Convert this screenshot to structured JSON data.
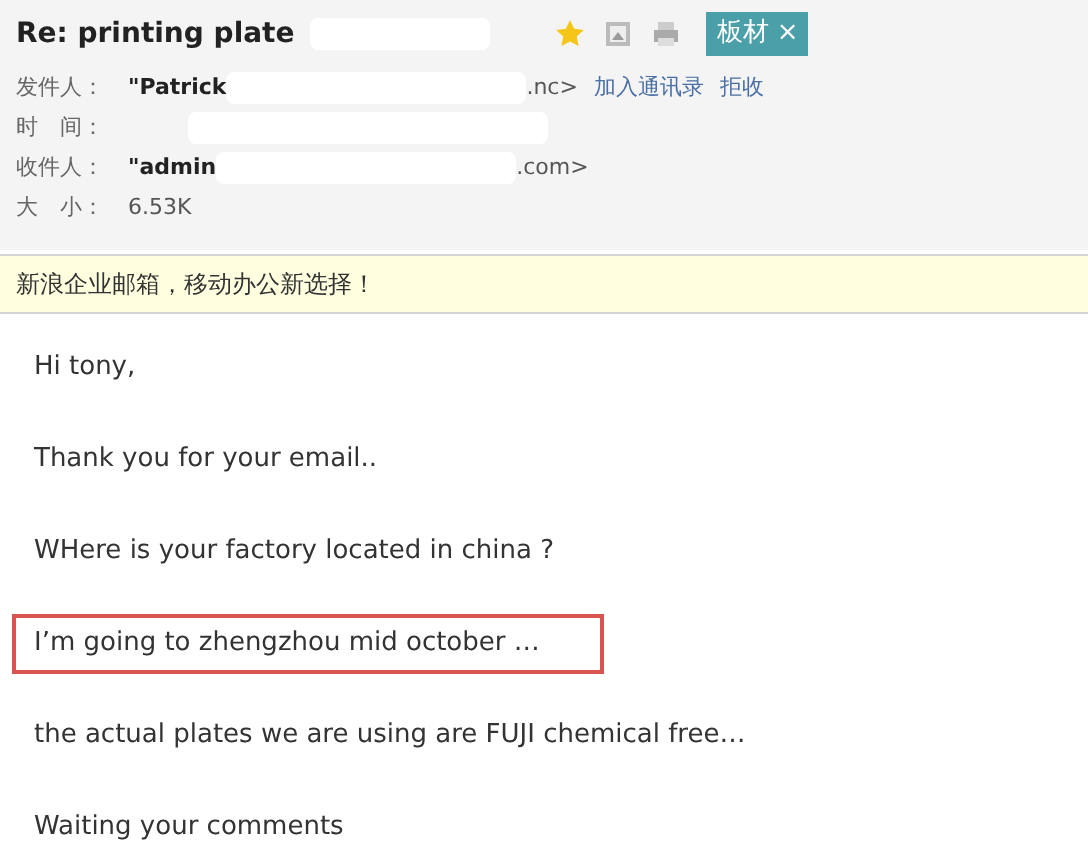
{
  "subject": "Re: printing plate",
  "tag": {
    "label": "板材",
    "close": "×"
  },
  "header_fields": [
    {
      "label": "发件人：",
      "name": "\"Patrick",
      "address_end": ".nc>",
      "actions": [
        "加入通讯录",
        "拒收"
      ]
    },
    {
      "label": "时　间："
    },
    {
      "label": "收件人：",
      "name": "\"admin",
      "address_end": ".com>"
    },
    {
      "label": "大　小：",
      "value": "6.53K"
    }
  ],
  "notice": "新浪企业邮箱，移动办公新选择！",
  "body": [
    {
      "text": "Hi tony,",
      "highlighted": false
    },
    {
      "text": "Thank you for your email..",
      "highlighted": false
    },
    {
      "text": "WHere is your factory located in china ?",
      "highlighted": false
    },
    {
      "text": "I’m going to zhengzhou mid october …",
      "highlighted": true
    },
    {
      "text": "the actual plates we are using are FUJI chemical free…",
      "highlighted": false
    },
    {
      "text": "Waiting your comments",
      "highlighted": false
    }
  ]
}
